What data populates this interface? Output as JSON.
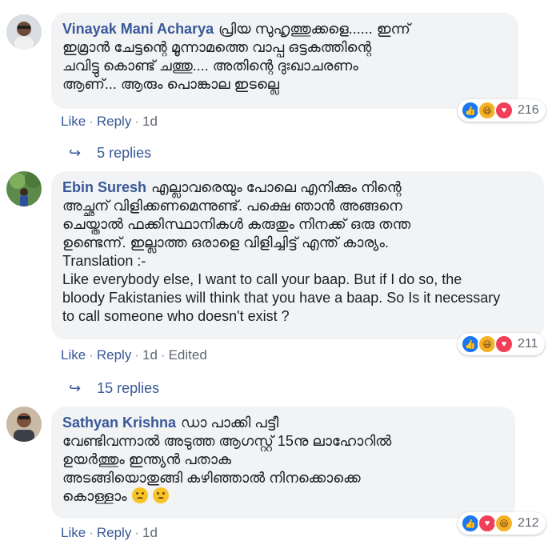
{
  "comments": [
    {
      "author": "Vinayak Mani Acharya",
      "text": "പ്രിയ സുഹൃത്തുക്കളെ...... ഇന്ന്\nഇമ്രാൻ ചേട്ടന്റെ മൂന്നാമത്തെ വാപ്പ ഒട്ടകത്തിന്റെ\nചവിട്ടു കൊണ്ട് ചത്തു.... അതിന്റെ ദുഃഖാചരണം\nആണ്... ആരും പൊങ്കാല ഇടല്ലെ",
      "like": "Like",
      "reply": "Reply",
      "time": "1d",
      "reaction_count": "216",
      "replies": "5 replies"
    },
    {
      "author": "Ebin Suresh",
      "text": "എല്ലാവരെയും പോലെ എനിക്കും നിന്റെ\nഅച്ഛന് വിളിക്കണമെന്നുണ്ട്. പക്ഷെ ഞാൻ അങ്ങനെ\nചെയ്താൽ ഫക്കിസ്ഥാനികൾ കരുതും നിനക്ക് ഒരു തന്ത\nഉണ്ടെന്ന്. ഇല്ലാത്ത ഒരാളെ വിളിച്ചിട്ട് എന്ത് കാര്യം.\nTranslation :-\nLike everybody else, I want to call your baap. But if I do so, the\nbloody Fakistanies will think that you have a baap. So Is it necessary\nto call someone who doesn't exist ?",
      "like": "Like",
      "reply": "Reply",
      "time": "1d",
      "edited": "Edited",
      "reaction_count": "211",
      "replies": "15 replies"
    },
    {
      "author": "Sathyan Krishna",
      "text": "ഡാ പാക്കി പട്ടീ\nവേണ്ടിവന്നാൽ അടുത്ത ആഗസ്റ്റ് 15നു ലാഹോറിൽ\nഉയർത്തും ഇന്ത്യൻ പതാക\nഅടങ്ങിയൊതുങ്ങി കഴിഞ്ഞാൽ നിനക്കൊക്കെ\nകൊള്ളാം",
      "like": "Like",
      "reply": "Reply",
      "time": "1d",
      "reaction_count": "212"
    }
  ],
  "separator": "·",
  "colors": {
    "link": "#385898",
    "bubble": "#f2f3f5",
    "meta": "#616770"
  },
  "icons": {
    "reply_arrow": "reply-arrow-icon",
    "like": "like-reaction-icon",
    "haha": "haha-reaction-icon",
    "love": "love-reaction-icon",
    "sad": "sad-emoji-icon"
  }
}
